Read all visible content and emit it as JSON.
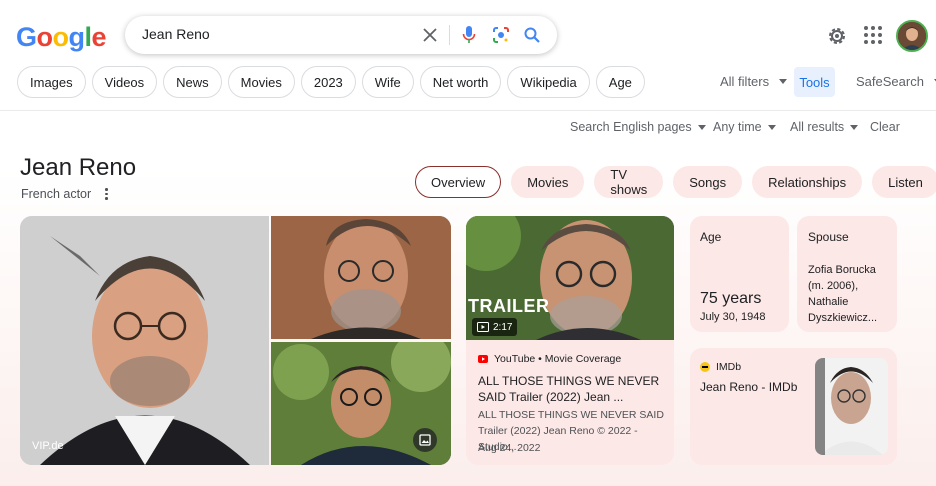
{
  "search": {
    "query": "Jean Reno"
  },
  "logo_letters": [
    "G",
    "o",
    "o",
    "g",
    "l",
    "e"
  ],
  "chips": [
    "Images",
    "Videos",
    "News",
    "Movies",
    "2023",
    "Wife",
    "Net worth",
    "Wikipedia",
    "Age"
  ],
  "filters": {
    "all_filters": "All filters",
    "tools": "Tools",
    "safesearch": "SafeSearch"
  },
  "tools_row": {
    "language": "Search English pages",
    "time": "Any time",
    "results": "All results",
    "clear": "Clear"
  },
  "entity": {
    "name": "Jean Reno",
    "subtitle": "French actor"
  },
  "tabs": [
    "Overview",
    "Movies",
    "TV shows",
    "Songs",
    "Relationships",
    "Listen"
  ],
  "images": {
    "main_credit": "VIP.de"
  },
  "video": {
    "thumb_text": "TRAILER",
    "duration": "2:17",
    "source": "YouTube • Movie Coverage",
    "title": "ALL THOSE THINGS WE NEVER SAID Trailer (2022) Jean ...",
    "desc": "ALL THOSE THINGS WE NEVER SAID Trailer (2022) Jean Reno © 2022 - Studio...",
    "date": "Aug 24, 2022"
  },
  "age_card": {
    "label": "Age",
    "value": "75 years",
    "date": "July 30, 1948"
  },
  "spouse_card": {
    "label": "Spouse",
    "value": "Zofia Borucka (m. 2006), Nathalie Dyszkiewicz..."
  },
  "imdb_card": {
    "source": "IMDb",
    "title": "Jean Reno - IMDb"
  }
}
